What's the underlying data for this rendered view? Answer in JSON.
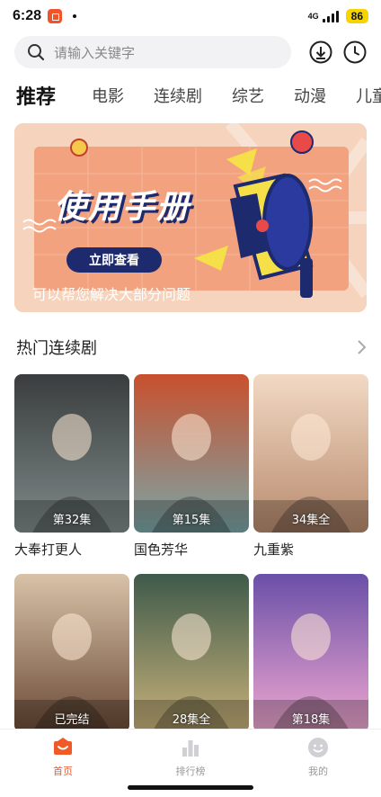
{
  "status_bar": {
    "time": "6:28",
    "network": "4G",
    "battery": "86",
    "notification_icon": "app-notification-icon"
  },
  "search": {
    "placeholder": "请输入关键字",
    "icons": [
      "search-icon",
      "download-icon",
      "history-clock-icon"
    ]
  },
  "tabs": [
    {
      "label": "推荐",
      "active": true
    },
    {
      "label": "电影",
      "active": false
    },
    {
      "label": "连续剧",
      "active": false
    },
    {
      "label": "综艺",
      "active": false
    },
    {
      "label": "动漫",
      "active": false
    },
    {
      "label": "儿童",
      "active": false
    }
  ],
  "banner": {
    "headline": "使用手册",
    "button_label": "立即查看",
    "caption": "可以帮您解决大部分问题",
    "colors": {
      "background": "#f3c8ae",
      "panel": "#f2a27e",
      "accent": "#1e2a6e",
      "yellow": "#f6e04a"
    }
  },
  "section": {
    "title": "热门连续剧",
    "more_icon": "chevron-right-icon"
  },
  "shows": [
    {
      "title": "大奉打更人",
      "badge": "第32集",
      "colors": [
        "#3a3d3e",
        "#7e8a88"
      ]
    },
    {
      "title": "国色芳华",
      "badge": "第15集",
      "colors": [
        "#c8502e",
        "#7aa6a8"
      ]
    },
    {
      "title": "九重紫",
      "badge": "34集全",
      "colors": [
        "#f2d9c4",
        "#b88b6e"
      ]
    },
    {
      "title": "",
      "badge": "已完结",
      "colors": [
        "#d8c2a8",
        "#6b4a36"
      ]
    },
    {
      "title": "",
      "badge": "28集全",
      "colors": [
        "#3e5a4a",
        "#c9b27a"
      ]
    },
    {
      "title": "",
      "badge": "第18集",
      "colors": [
        "#6a4fa8",
        "#f0a8d0"
      ]
    }
  ],
  "bottom_nav": [
    {
      "label": "首页",
      "icon": "home-icon",
      "active": true
    },
    {
      "label": "排行榜",
      "icon": "ranking-icon",
      "active": false
    },
    {
      "label": "我的",
      "icon": "profile-icon",
      "active": false
    }
  ],
  "accent_color": "#f05a28"
}
